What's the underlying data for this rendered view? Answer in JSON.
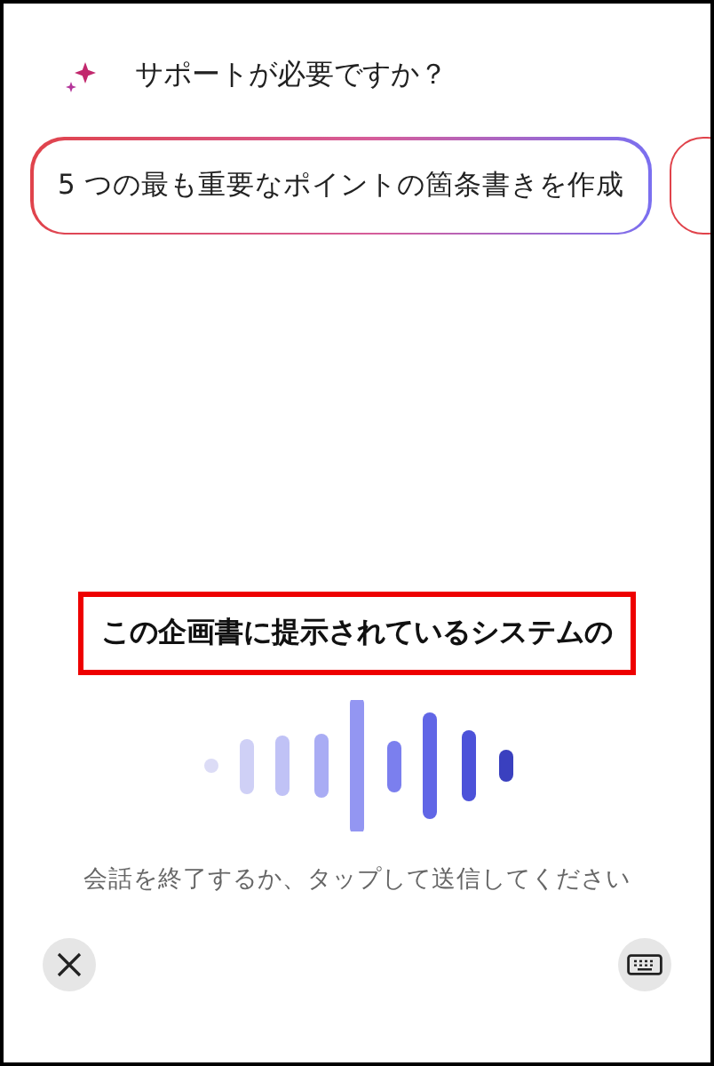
{
  "header": {
    "title": "サポートが必要ですか？"
  },
  "suggestions": [
    "5 つの最も重要なポイントの箇条書きを作成"
  ],
  "transcript": {
    "text": "この企画書に提示されているシステムの",
    "highlighted": true
  },
  "hint": "会話を終了するか、タップして送信してください"
}
